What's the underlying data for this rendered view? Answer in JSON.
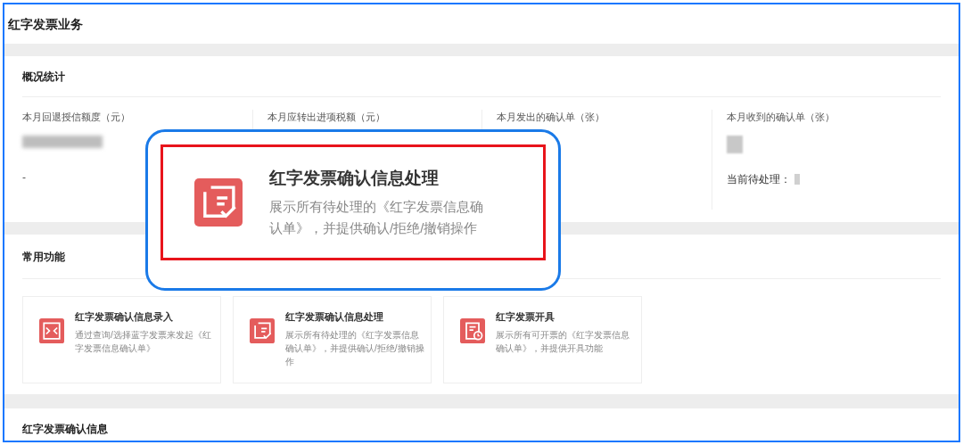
{
  "page_title": "红字发票业务",
  "overview": {
    "title": "概况统计",
    "stats": [
      {
        "label": "本月回退授信额度（元）",
        "value": "-",
        "kind": "blurred"
      },
      {
        "label": "本月应转出进项税额（元）",
        "kind": "plain"
      },
      {
        "label": "本月发出的确认单（张）",
        "kind": "plain"
      },
      {
        "label": "本月收到的确认单（张）",
        "kind": "blurred",
        "pending_label": "当前待处理："
      }
    ]
  },
  "common_functions": {
    "title": "常用功能",
    "cards": [
      {
        "kind": "entry",
        "title": "红字发票确认信息录入",
        "desc": "通过查询/选择蓝字发票来发起《红字发票信息确认单》"
      },
      {
        "kind": "process",
        "title": "红字发票确认信息处理",
        "desc": "展示所有待处理的《红字发票信息确认单》，并提供确认/拒绝/撤销操作"
      },
      {
        "kind": "issue",
        "title": "红字发票开具",
        "desc": "展示所有可开票的《红字发票信息确认单》，并提供开具功能"
      }
    ]
  },
  "callout": {
    "kind": "process",
    "title": "红字发票确认信息处理",
    "desc": "展示所有待处理的《红字发票信息确认单》，并提供确认/拒绝/撤销操作"
  },
  "confirm_section": {
    "title": "红字发票确认信息"
  }
}
